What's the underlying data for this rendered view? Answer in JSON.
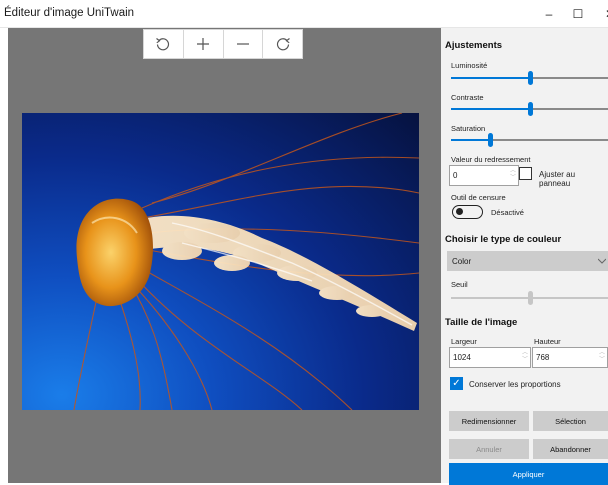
{
  "window": {
    "title": "Éditeur d'image UniTwain",
    "minimize_glyph": "–",
    "maximize_glyph": "☐",
    "close_glyph": "✕"
  },
  "toolbar": {
    "rotate_left_icon": "rotate-left-icon",
    "zoom_in_icon": "plus-icon",
    "zoom_out_icon": "minus-icon",
    "rotate_right_icon": "rotate-right-icon"
  },
  "panel": {
    "adjustments": {
      "heading": "Ajustements",
      "brightness_label": "Luminosité",
      "brightness_value": 0.5,
      "contrast_label": "Contraste",
      "contrast_value": 0.5,
      "saturation_label": "Saturation",
      "saturation_value": 0.25,
      "straighten_label": "Valeur du redressement",
      "straighten_value": "0",
      "fit_panel_label": "Ajuster au panneau",
      "fit_panel_checked": false,
      "censor_label": "Outil de censure",
      "censor_state": "Désactivé"
    },
    "color": {
      "heading": "Choisir le type de couleur",
      "selected": "Color",
      "threshold_label": "Seuil",
      "threshold_value": 0.5
    },
    "size": {
      "heading": "Taille de l'image",
      "width_label": "Largeur",
      "width_value": "1024",
      "height_label": "Hauteur",
      "height_value": "768",
      "keep_ratio_label": "Conserver les proportions",
      "keep_ratio_checked": true
    },
    "buttons": {
      "resize": "Redimensionner",
      "selection": "Sélection",
      "cancel": "Annuler",
      "abandon": "Abandonner",
      "apply": "Appliquer"
    }
  },
  "colors": {
    "accent": "#0078d7",
    "canvas_bg": "#767676",
    "panel_bg": "#f2f2f2"
  }
}
